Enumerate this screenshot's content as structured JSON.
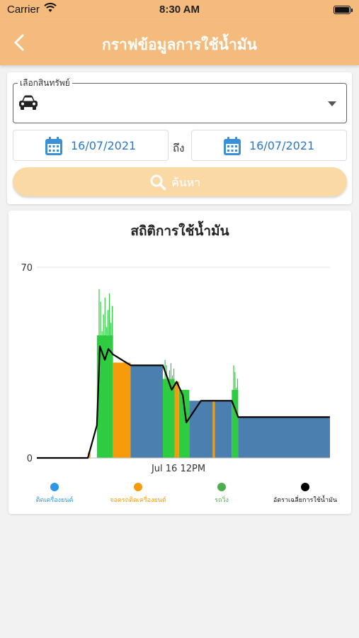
{
  "status_bar": {
    "carrier": "Carrier",
    "time": "8:30 AM"
  },
  "nav": {
    "title": "กราฟข้อมูลการใช้น้ำมัน",
    "back_icon": "chevron-left-icon"
  },
  "filter": {
    "asset_label": "เลือกสินทรัพย์",
    "asset_icon": "car-icon",
    "from_date": "16/07/2021",
    "to_label": "ถึง",
    "to_date": "16/07/2021",
    "search_label": "ค้นหา"
  },
  "chart": {
    "title": "สถิติการใช้น้ำมัน",
    "x_tick": "Jul 16 12PM"
  },
  "legend": [
    {
      "label": "ติดเครื่องยนต์",
      "color": "#2e96e6"
    },
    {
      "label": "จอดรถติดเครื่องยนต์",
      "color": "#f59b0c"
    },
    {
      "label": "รถวิ่ง",
      "color": "#4cae4c"
    },
    {
      "label": "อัตราเฉลี่ยการใช้น้ำมัน",
      "color": "#000000"
    }
  ],
  "colors": {
    "header": "#f4bb7c",
    "idle": "#4a7fb0",
    "parked": "#f59b0c",
    "moving": "#2ecc40",
    "average": "#000000"
  },
  "chart_data": {
    "type": "area",
    "xlabel": "",
    "ylabel": "",
    "ylim": [
      0,
      70
    ],
    "y_ticks": [
      0,
      70
    ],
    "x_tick_labels": [
      "Jul 16 12PM"
    ],
    "x_range": [
      0,
      100
    ],
    "segments": [
      {
        "state": "parked",
        "x0": 17.4,
        "x1": 18.3,
        "y": 2
      },
      {
        "state": "moving",
        "x0": 20.5,
        "x1": 26.0,
        "y": 45,
        "peak": 62
      },
      {
        "state": "parked",
        "x0": 26.0,
        "x1": 32.0,
        "y": 35
      },
      {
        "state": "idle",
        "x0": 32.0,
        "x1": 43.0,
        "y": 34
      },
      {
        "state": "moving",
        "x0": 43.0,
        "x1": 47.0,
        "y": 29,
        "peak": 36
      },
      {
        "state": "parked",
        "x0": 47.0,
        "x1": 48.5,
        "y": 28
      },
      {
        "state": "moving",
        "x0": 48.5,
        "x1": 52.0,
        "y": 25
      },
      {
        "state": "idle",
        "x0": 52.0,
        "x1": 60.0,
        "y": 21
      },
      {
        "state": "parked",
        "x0": 60.0,
        "x1": 60.7,
        "y": 21
      },
      {
        "state": "idle",
        "x0": 60.7,
        "x1": 66.5,
        "y": 21
      },
      {
        "state": "moving",
        "x0": 66.5,
        "x1": 68.7,
        "y": 25,
        "peak": 34
      },
      {
        "state": "idle",
        "x0": 68.7,
        "x1": 100.0,
        "y": 15
      }
    ],
    "series": [
      {
        "name": "อัตราเฉลี่ยการใช้น้ำมัน",
        "x": [
          0,
          17.4,
          20.5,
          21.5,
          23.2,
          24.4,
          26.0,
          32.0,
          43.0,
          44.0,
          46.0,
          47.7,
          49.8,
          51.0,
          56.0,
          60.0,
          66.5,
          68.7,
          80.0,
          100.0
        ],
        "values": [
          0,
          0,
          12,
          41,
          36,
          40,
          38,
          34,
          34,
          31,
          25,
          28,
          23,
          13,
          21,
          21,
          21,
          15,
          15,
          15
        ]
      }
    ]
  }
}
